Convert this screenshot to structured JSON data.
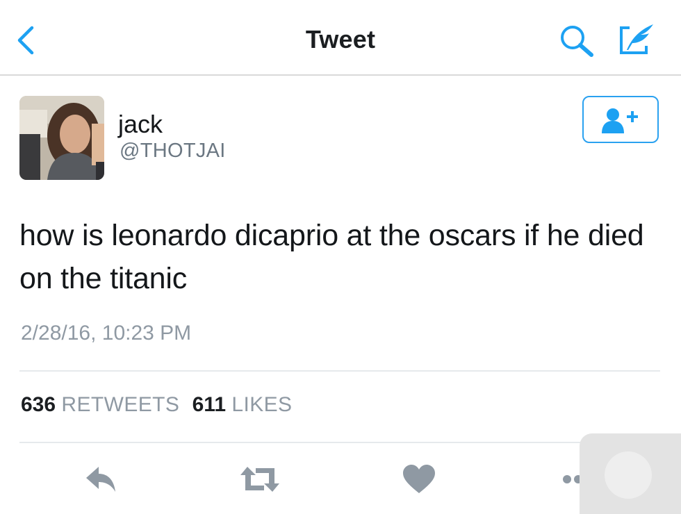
{
  "nav": {
    "title": "Tweet",
    "back_icon": "chevron-left-icon",
    "search_icon": "search-icon",
    "compose_icon": "compose-tweet-icon",
    "accent_color": "#1da1f2"
  },
  "author": {
    "display_name": "jack",
    "handle": "@THOTJAI",
    "follow_icon": "add-user-icon"
  },
  "tweet": {
    "text": "how is leonardo dicaprio at the oscars if he died on the titanic",
    "timestamp": "2/28/16, 10:23 PM"
  },
  "stats": {
    "retweets_count": "636",
    "retweets_label": "RETWEETS",
    "likes_count": "611",
    "likes_label": "LIKES"
  },
  "actions": [
    "reply-icon",
    "retweet-icon",
    "like-icon",
    "more-icon"
  ]
}
